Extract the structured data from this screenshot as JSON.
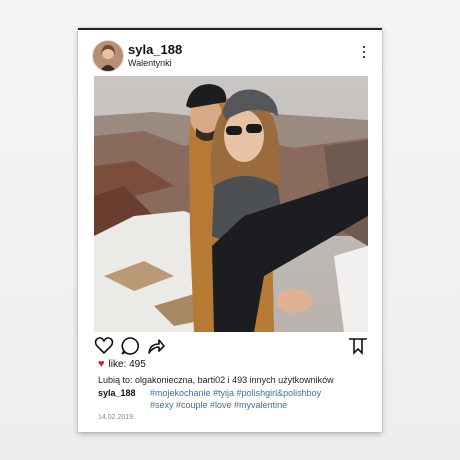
{
  "post": {
    "username": "syla_188",
    "location": "Walentynki",
    "likes_label": "like: 495",
    "liked_by_prefix": "Lubią to: ",
    "liked_by_text": "olgakonieczna, barti02 i 493 innych użytkowników",
    "caption_user": "syla_188",
    "hashtags_line1": "#mojekochanie #tyija #polishgirl&polishboy",
    "hashtags_line2": "#sexy #couple #love #myvalentine",
    "date": "14.02.2019"
  },
  "colors": {
    "heart": "#c0262d",
    "hashtag": "#3b6fb6",
    "background": "#f1f1f0"
  },
  "icons": [
    "more-options-icon",
    "heart-icon",
    "comment-icon",
    "share-icon",
    "bookmark-icon",
    "small-heart-icon"
  ]
}
